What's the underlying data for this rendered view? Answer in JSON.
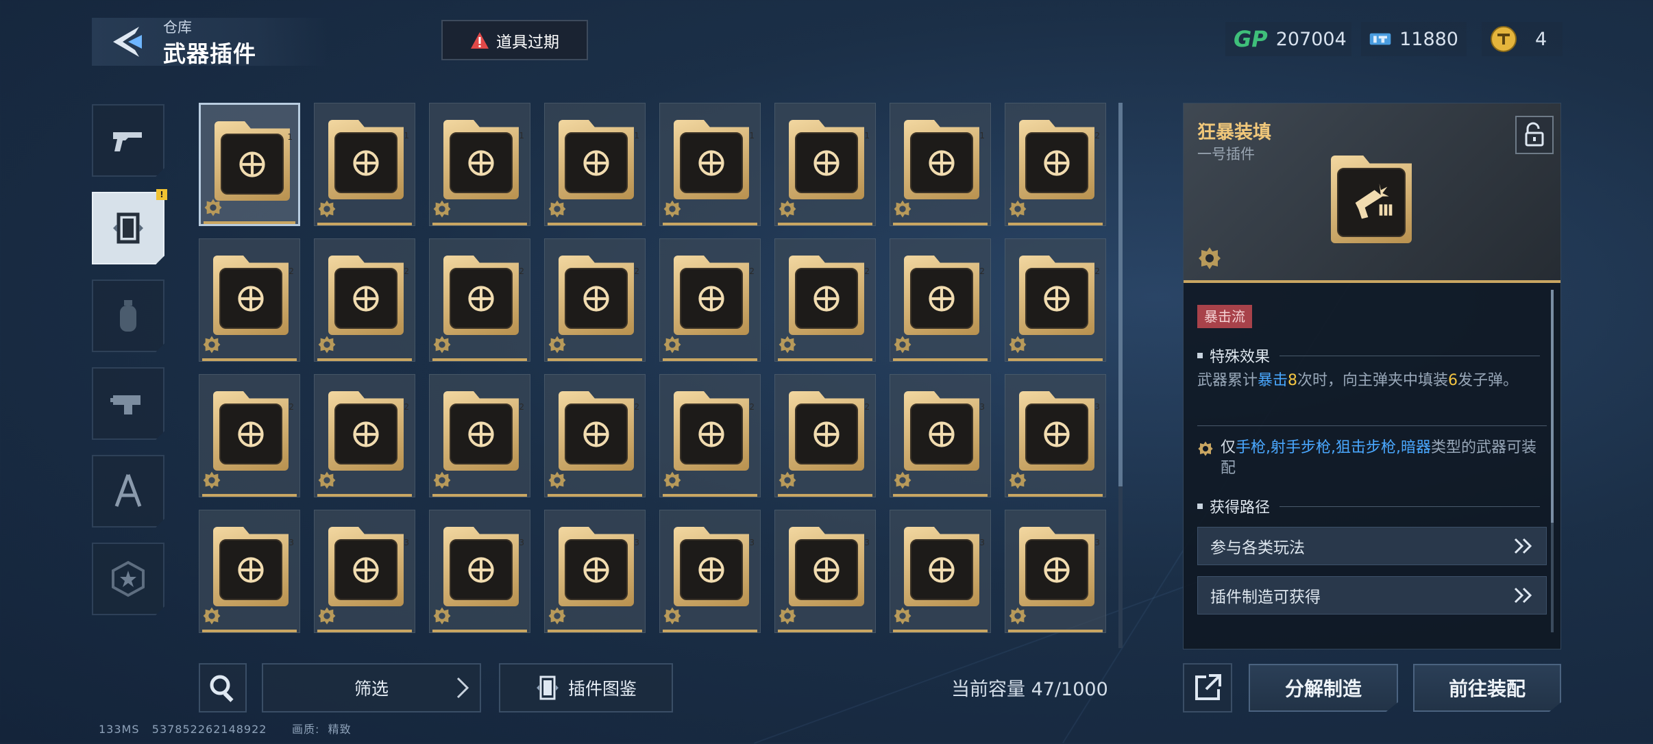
{
  "header": {
    "breadcrumb": "仓库",
    "title": "武器插件",
    "expire_label": "道具过期"
  },
  "currencies": [
    {
      "icon": "gp-icon",
      "value": "207004"
    },
    {
      "icon": "ticket-icon",
      "value": "11880"
    },
    {
      "icon": "coin-icon",
      "value": "4"
    }
  ],
  "sidebar": {
    "tabs": [
      "pistol-icon",
      "plugin-card-icon",
      "grenade-icon",
      "attachment-icon",
      "compass-icon",
      "star-badge-icon"
    ],
    "active_index": 1,
    "badge": "!"
  },
  "grid": {
    "items": [
      {
        "icon": "pistol-crit-icon",
        "level": "1"
      },
      {
        "icon": "bullets-up-icon",
        "level": "1"
      },
      {
        "icon": "target-up-icon",
        "level": "1"
      },
      {
        "icon": "target-up-icon",
        "level": "1"
      },
      {
        "icon": "arrows-split-icon",
        "level": "1"
      },
      {
        "icon": "hand-cycle-icon",
        "level": "1"
      },
      {
        "icon": "head-hex-icon",
        "level": "1"
      },
      {
        "icon": "skull-target-icon",
        "level": "2"
      },
      {
        "icon": "bullet-speed-icon",
        "level": "2"
      },
      {
        "icon": "hex-target-icon",
        "level": "2"
      },
      {
        "icon": "hex-target-icon",
        "level": "2"
      },
      {
        "icon": "fist-cycle-icon",
        "level": "2"
      },
      {
        "icon": "fist-cycle-icon",
        "level": "2"
      },
      {
        "icon": "impact-down-icon",
        "level": "2"
      },
      {
        "icon": "impact-down-icon",
        "level": "2"
      },
      {
        "icon": "bullet-hex-icon",
        "level": "2"
      },
      {
        "icon": "triad-icon",
        "level": "2"
      },
      {
        "icon": "robot-arrows-icon",
        "level": "2"
      },
      {
        "icon": "robot-arrows-icon",
        "level": "2"
      },
      {
        "icon": "robot-arrows-icon",
        "level": "2"
      },
      {
        "icon": "arrows-up-ring-icon",
        "level": "2"
      },
      {
        "icon": "anchor-icon",
        "level": "2"
      },
      {
        "icon": "meteor-icon",
        "level": "3"
      },
      {
        "icon": "target-up-icon",
        "level": "3"
      },
      {
        "icon": "rifle-hex-icon",
        "level": "3"
      },
      {
        "icon": "bullet-chevron-icon",
        "level": "3"
      },
      {
        "icon": "burst-down-icon",
        "level": "3"
      },
      {
        "icon": "burst-down-icon",
        "level": "3"
      },
      {
        "icon": "ammo-swap-icon",
        "level": "3"
      },
      {
        "icon": "ammo-swap-icon",
        "level": "3"
      },
      {
        "icon": "burst-down-icon",
        "level": "3"
      },
      {
        "icon": "hex-star-icon",
        "level": "3"
      }
    ],
    "selected_index": 0
  },
  "bottom": {
    "filter_label": "筛选",
    "codex_label": "插件图鉴",
    "capacity_label": "当前容量",
    "capacity_value": "47/1000"
  },
  "status": {
    "ping": "133MS",
    "uid": "537852262148922",
    "quality_label": "画质:",
    "quality_value": "精致"
  },
  "detail": {
    "name": "狂暴装填",
    "subtitle": "一号插件",
    "tag": "暴击流",
    "effect_title": "特殊效果",
    "effect_parts": [
      "武器累计",
      "暴击",
      "8",
      "次时，向主弹夹中填装",
      "6",
      "发子弹。"
    ],
    "restrict_parts": [
      "仅",
      "手枪,射手步枪,狙击步枪,暗器",
      "类型的武器可装配"
    ],
    "source_title": "获得路径",
    "sources": [
      "参与各类玩法",
      "插件制造可获得"
    ],
    "decompose_label": "分解制造",
    "equip_label": "前往装配"
  },
  "colors": {
    "accent_gold": "#c9a662",
    "highlight_blue": "#4aa8ff",
    "highlight_gold": "#f4c542",
    "tag_red": "#a8424a",
    "warning_red": "#e04848",
    "gp_green": "#3fbf7a"
  }
}
